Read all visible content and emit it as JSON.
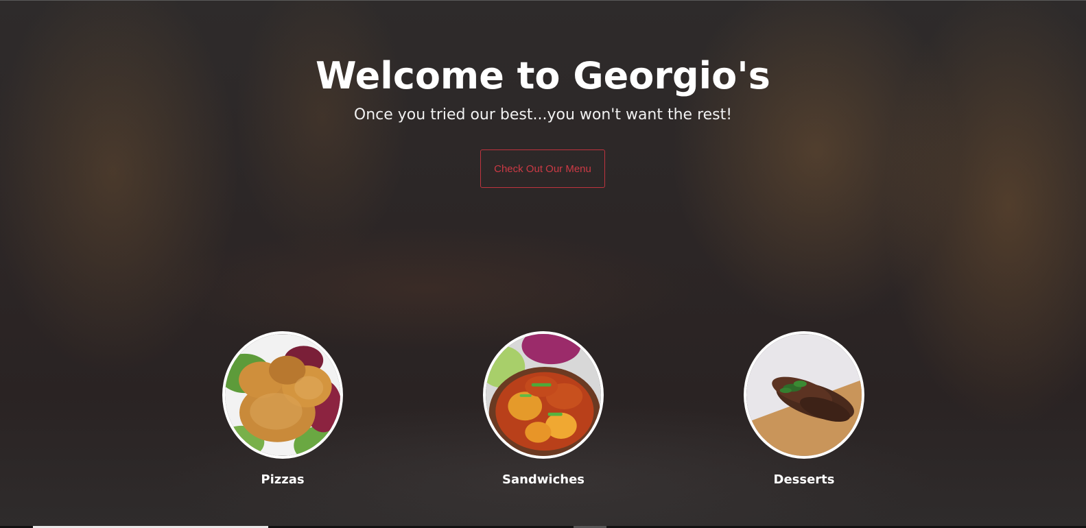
{
  "hero": {
    "title": "Welcome to Georgio's",
    "subtitle": "Once you tried our best...you won't want the rest!",
    "cta_label": "Check Out Our Menu"
  },
  "categories": [
    {
      "label": "Pizzas",
      "image": "fried-chicken-photo"
    },
    {
      "label": "Sandwiches",
      "image": "stew-potatoes-photo"
    },
    {
      "label": "Desserts",
      "image": "grilled-chicken-photo"
    }
  ],
  "colors": {
    "accent": "#cc3a45",
    "text": "#ffffff",
    "background": "#2e2b2b"
  }
}
